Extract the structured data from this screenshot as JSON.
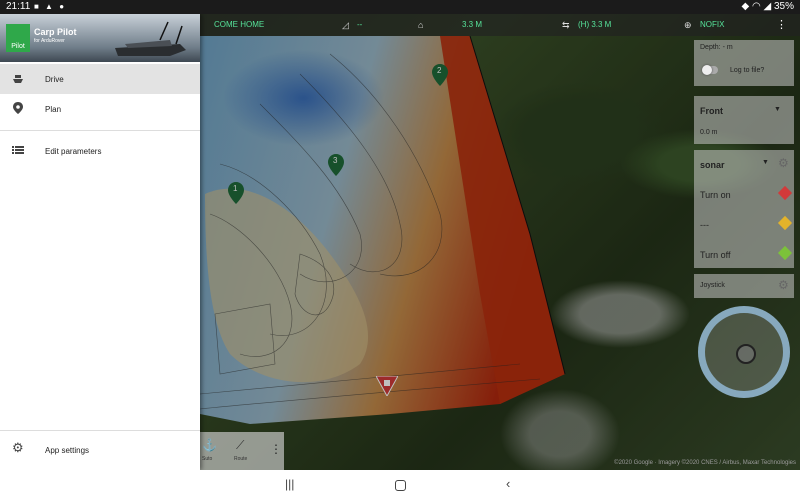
{
  "status_bar": {
    "time": "21:11",
    "battery": "35%"
  },
  "top_bar": {
    "come_home": "COME HOME",
    "heading": "--",
    "distance": "3.3 M",
    "height": "(H) 3.3 M",
    "gps": "NOFIX"
  },
  "map": {
    "waypoints": [
      "1",
      "2",
      "3"
    ],
    "attribution": "©2020 Google · Imagery ©2020 CNES / Airbus, Maxar Technologies"
  },
  "right_panel": {
    "depth": "Depth: - m",
    "log_label": "Log to file?",
    "front_select": "Front",
    "front_value": "0.0 m",
    "sonar_select": "sonar",
    "turn_on": "Turn on",
    "dash": "---",
    "turn_off": "Turn off",
    "joystick": "Joystick"
  },
  "bottom_toolbar": {
    "left_label": "Suto",
    "route_label": "Route"
  },
  "drawer": {
    "app_title": "Carp Pilot",
    "app_subtitle": "for ArduRover",
    "logo_text": "Pilot",
    "items": [
      {
        "label": "Drive"
      },
      {
        "label": "Plan"
      },
      {
        "label": "Edit parameters"
      }
    ],
    "settings_label": "App settings"
  },
  "colors": {
    "accent_green": "#56e39a",
    "marker_green": "#1f6b3a",
    "home_red": "#d23a3a"
  }
}
